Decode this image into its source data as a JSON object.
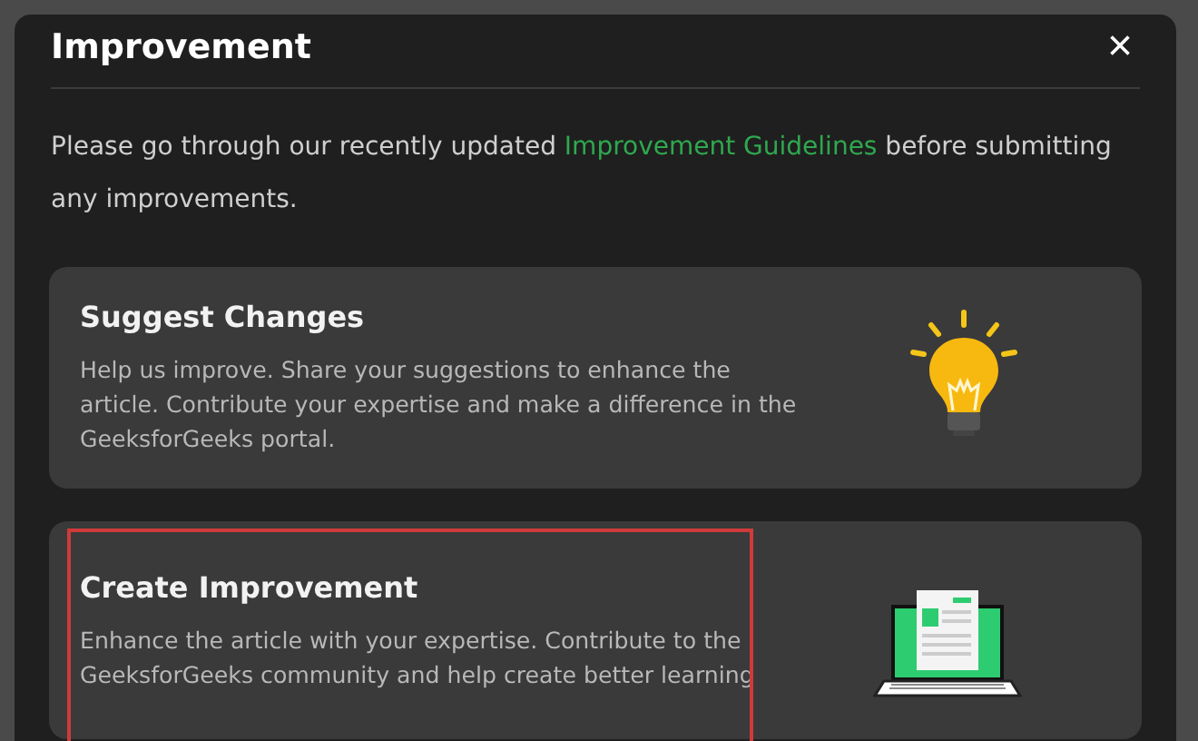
{
  "dialog": {
    "title": "Improvement",
    "close": "×"
  },
  "intro": {
    "before": "Please go through our recently updated ",
    "link": "Improvement Guidelines",
    "after": " before submitting any improvements."
  },
  "options": [
    {
      "kind": "suggest",
      "title": "Suggest Changes",
      "description": "Help us improve. Share your suggestions to enhance the article. Contribute your expertise and make a difference in the GeeksforGeeks portal.",
      "highlighted": false
    },
    {
      "kind": "create",
      "title": "Create Improvement",
      "description": "Enhance the article with your expertise. Contribute to the GeeksforGeeks community and help create better learning",
      "highlighted": true
    }
  ]
}
